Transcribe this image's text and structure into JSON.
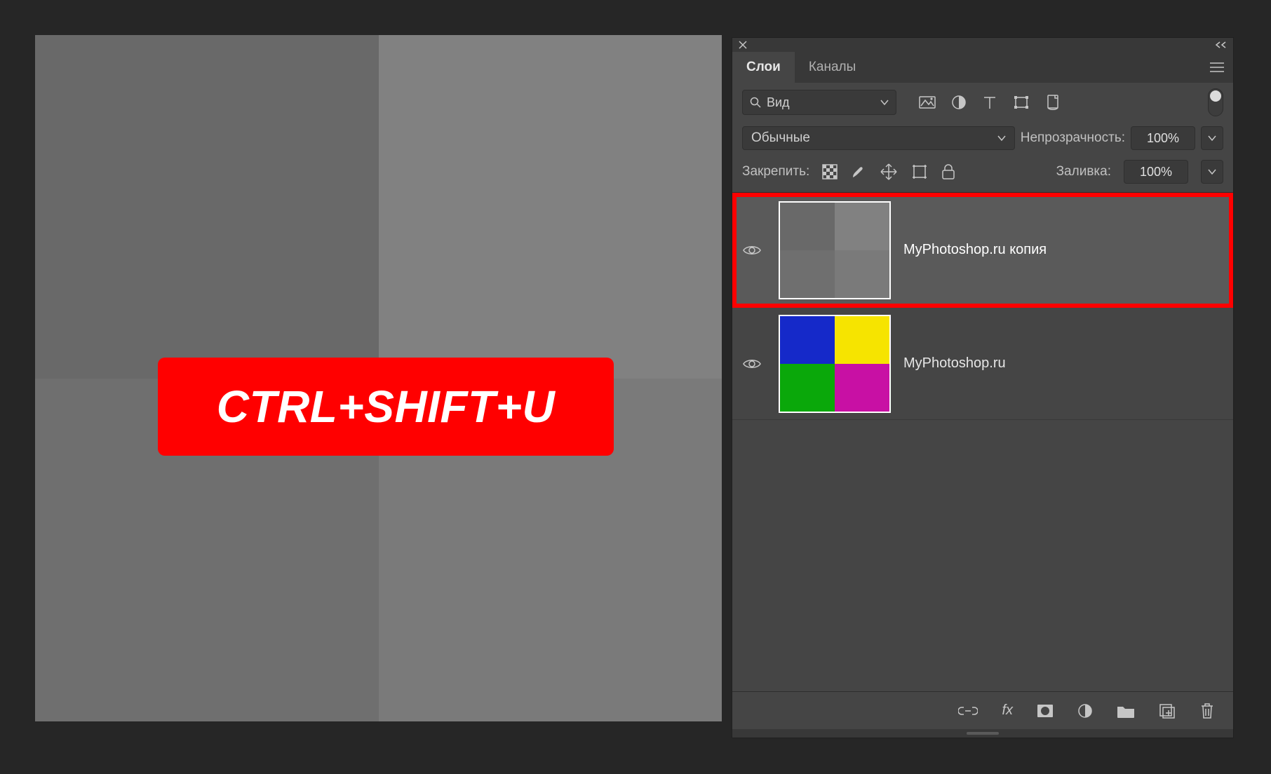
{
  "canvas": {
    "shortcut_text": "CTRL+SHIFT+U",
    "quad_colors": {
      "tl": "#696969",
      "tr": "#818181",
      "bl": "#6f6f6f",
      "br": "#7a7a7a"
    }
  },
  "panel": {
    "tabs": [
      {
        "label": "Слои",
        "active": true
      },
      {
        "label": "Каналы",
        "active": false
      }
    ],
    "search_label": "Вид",
    "blend_mode": "Обычные",
    "opacity_label": "Непрозрачность:",
    "opacity_value": "100%",
    "lock_label": "Закрепить:",
    "fill_label": "Заливка:",
    "fill_value": "100%"
  },
  "layers": [
    {
      "name": "MyPhotoshop.ru копия",
      "visible": true,
      "selected": true,
      "thumb": {
        "tl": "#696969",
        "tr": "#818181",
        "bl": "#6f6f6f",
        "br": "#7a7a7a"
      }
    },
    {
      "name": "MyPhotoshop.ru",
      "visible": true,
      "selected": false,
      "thumb": {
        "tl": "#1529c9",
        "tr": "#f6e400",
        "bl": "#0aa80a",
        "br": "#c810a4"
      }
    }
  ]
}
